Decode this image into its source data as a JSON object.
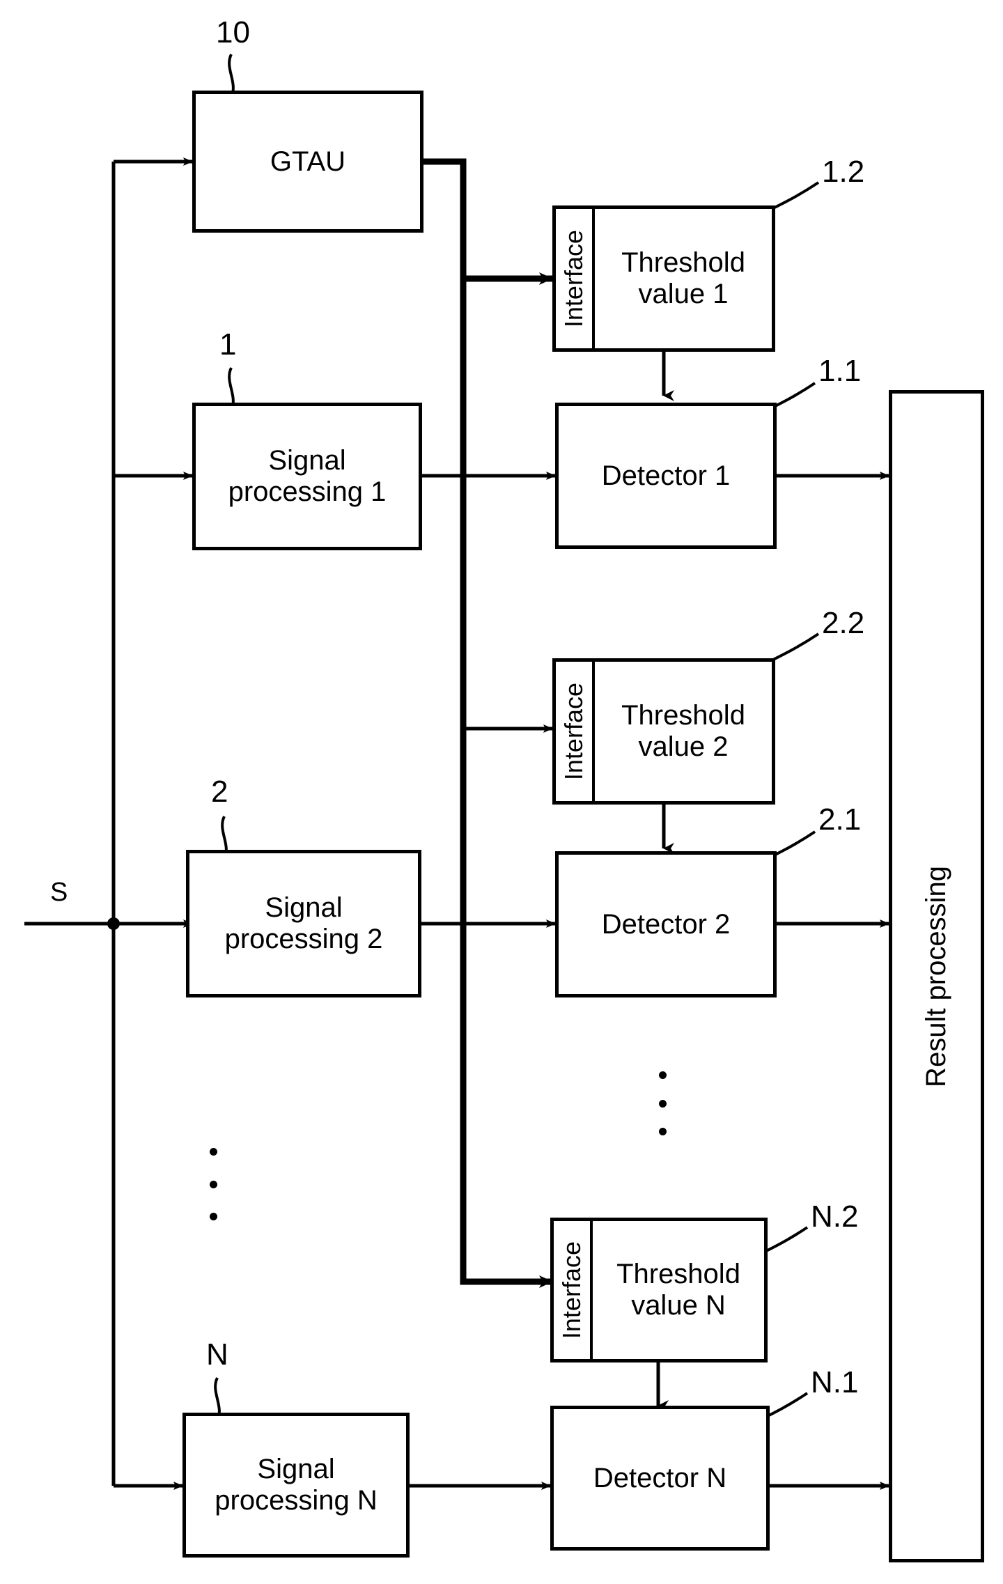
{
  "figure": {
    "type": "patent-block-diagram",
    "background": "#ffffff",
    "line_color": "#000000"
  },
  "input": {
    "signal_label": "S"
  },
  "blocks": {
    "gtau": {
      "label": "GTAU",
      "ref": "10"
    },
    "signal_processing": [
      {
        "label": "Signal\nprocessing 1",
        "ref": "1"
      },
      {
        "label": "Signal\nprocessing 2",
        "ref": "2"
      },
      {
        "label": "Signal\nprocessing N",
        "ref": "N"
      }
    ],
    "thresholds": [
      {
        "interface": "Interface",
        "label": "Threshold\nvalue 1",
        "ref": "1.2"
      },
      {
        "interface": "Interface",
        "label": "Threshold\nvalue 2",
        "ref": "2.2"
      },
      {
        "interface": "Interface",
        "label": "Threshold\nvalue N",
        "ref": "N.2"
      }
    ],
    "detectors": [
      {
        "label": "Detector 1",
        "ref": "1.1"
      },
      {
        "label": "Detector 2",
        "ref": "2.1"
      },
      {
        "label": "Detector N",
        "ref": "N.1"
      }
    ],
    "result": {
      "label": "Result processing"
    }
  },
  "ellipsis": {
    "left_dots": 3,
    "middle_dots": 3
  }
}
